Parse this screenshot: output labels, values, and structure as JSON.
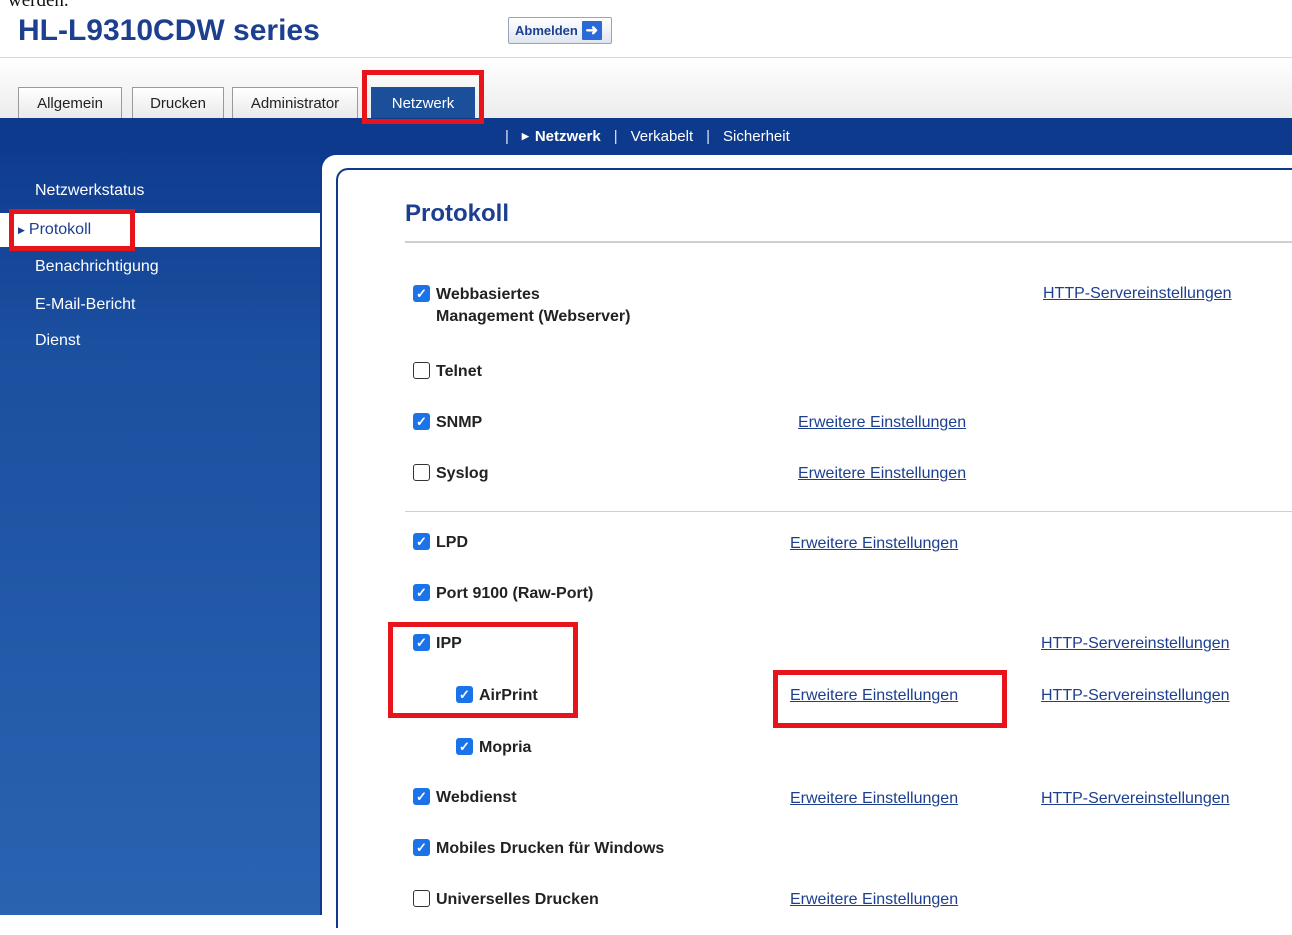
{
  "header": {
    "cut_text": "werden.",
    "model": "HL-L9310CDW series",
    "logout_label": "Abmelden",
    "logout_icon": "arrow-right-icon"
  },
  "tabs": [
    {
      "label": "Allgemein"
    },
    {
      "label": "Drucken"
    },
    {
      "label": "Administrator"
    },
    {
      "label": "Netzwerk",
      "active": true
    }
  ],
  "subnav": [
    {
      "label": "Netzwerk",
      "current": true
    },
    {
      "label": "Verkabelt"
    },
    {
      "label": "Sicherheit"
    }
  ],
  "sidebar": [
    {
      "label": "Netzwerkstatus"
    },
    {
      "label": "Protokoll",
      "active": true
    },
    {
      "label": "Benachrichtigung"
    },
    {
      "label": "E-Mail-Bericht"
    },
    {
      "label": "Dienst"
    }
  ],
  "page": {
    "title": "Protokoll",
    "link_adv": "Erweitere Einstellungen",
    "link_http": "HTTP-Servereinstellungen",
    "protocols": [
      {
        "label": "Webbasiertes",
        "label2": "Management (Webserver)",
        "checked": true
      },
      {
        "label": "Telnet",
        "checked": false
      },
      {
        "label": "SNMP",
        "checked": true
      },
      {
        "label": "Syslog",
        "checked": false
      },
      {
        "label": "LPD",
        "checked": true
      },
      {
        "label": "Port 9100 (Raw-Port)",
        "checked": true
      },
      {
        "label": "IPP",
        "checked": true
      },
      {
        "label": "AirPrint",
        "checked": true
      },
      {
        "label": "Mopria",
        "checked": true
      },
      {
        "label": "Webdienst",
        "checked": true
      },
      {
        "label": "Mobiles Drucken für Windows",
        "checked": true
      },
      {
        "label": "Universelles Drucken",
        "checked": false
      }
    ]
  },
  "colors": {
    "brand_blue": "#1c3f8f",
    "nav_blue": "#0d3a8c",
    "checkbox_blue": "#1a73e8",
    "highlight_red": "#e8141b"
  }
}
